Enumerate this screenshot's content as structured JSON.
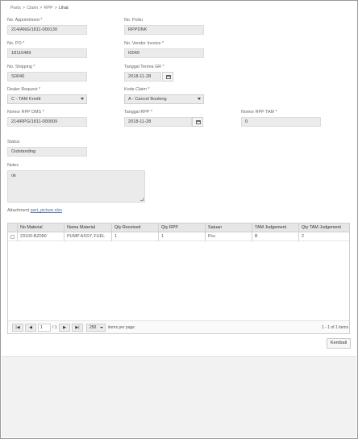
{
  "breadcrumb": {
    "items": [
      "Parts",
      "Claim",
      "RPP",
      "Lihat"
    ]
  },
  "form": {
    "no_appointment": {
      "label": "No. Appointment *",
      "value": "214/ANG/1811-000130"
    },
    "no_polisi": {
      "label": "No. Polisi",
      "value": "RPPDNK"
    },
    "no_po": {
      "label": "No. PO *",
      "value": "18110489"
    },
    "no_vendor_invoice": {
      "label": "No. Vendor Invoice *",
      "value": "I0040"
    },
    "no_shipping": {
      "label": "No. Shipping *",
      "value": "S0040"
    },
    "tanggal_terima_gr": {
      "label": "Tanggal Terima GR *",
      "value": "2018-11-28"
    },
    "dealer_request": {
      "label": "Dealer Request *",
      "value": "C - TAM Kredit"
    },
    "kode_claim": {
      "label": "Kode Claim *",
      "value": "A - Cancel Booking"
    },
    "nomor_rpp_dms": {
      "label": "Nomor RPP DMS *",
      "value": "214/RPG/1811-000009"
    },
    "tanggal_rpp": {
      "label": "Tanggal RPP *",
      "value": "2018-11-28"
    },
    "nomor_rpp_tam": {
      "label": "Nomor RPP TAM *",
      "value": "0"
    },
    "status": {
      "label": "Status",
      "value": "Outstanding"
    },
    "notes": {
      "label": "Notes",
      "value": "ok"
    },
    "attachment": {
      "label": "Attachment",
      "link": "part_picture.xlsx"
    }
  },
  "grid": {
    "columns": [
      "No Material",
      "Nama Material",
      "Qty Received",
      "Qty RPP",
      "Satuan",
      "TAM Judgement",
      "Qty TAM Judgement"
    ],
    "rows": [
      [
        "23100-BZ090",
        "PUMP ASSY, FUEL",
        "1",
        "1",
        "Pcs",
        "B",
        "2"
      ]
    ],
    "pager": {
      "first": "|◀",
      "prev": "◀",
      "next": "▶",
      "last": "▶|",
      "page": "1",
      "of": "/ 1",
      "page_size": "250",
      "items_per_page": "items per page",
      "summary": "1 - 1 of 1 items"
    }
  },
  "actions": {
    "back_label": "Kembali"
  }
}
